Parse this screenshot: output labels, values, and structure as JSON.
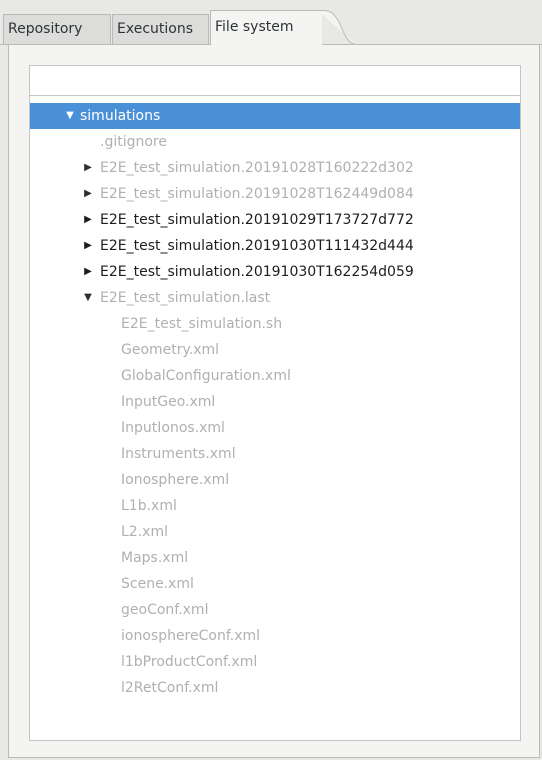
{
  "tabs": [
    {
      "label": "Repository"
    },
    {
      "label": "Executions"
    },
    {
      "label": "File system"
    }
  ],
  "search": {
    "value": "",
    "placeholder": ""
  },
  "tree": {
    "root": "simulations",
    "children": [
      {
        "label": ".gitignore",
        "type": "file"
      },
      {
        "label": "E2E_test_simulation.20191028T160222d302",
        "type": "folder"
      },
      {
        "label": "E2E_test_simulation.20191028T162449d084",
        "type": "folder"
      },
      {
        "label": "E2E_test_simulation.20191029T173727d772",
        "type": "folder"
      },
      {
        "label": "E2E_test_simulation.20191030T111432d444",
        "type": "folder"
      },
      {
        "label": "E2E_test_simulation.20191030T162254d059",
        "type": "folder"
      },
      {
        "label": "E2E_test_simulation.last",
        "type": "folder-expanded"
      }
    ],
    "last_children": [
      "E2E_test_simulation.sh",
      "Geometry.xml",
      "GlobalConfiguration.xml",
      "InputGeo.xml",
      "InputIonos.xml",
      "Instruments.xml",
      "Ionosphere.xml",
      "L1b.xml",
      "L2.xml",
      "Maps.xml",
      "Scene.xml",
      "geoConf.xml",
      "ionosphereConf.xml",
      "l1bProductConf.xml",
      "l2RetConf.xml"
    ]
  },
  "colors": {
    "selection": "#4a90d9",
    "dimmed_text": "#b0b0b0",
    "normal_text": "#1e1e1e"
  }
}
